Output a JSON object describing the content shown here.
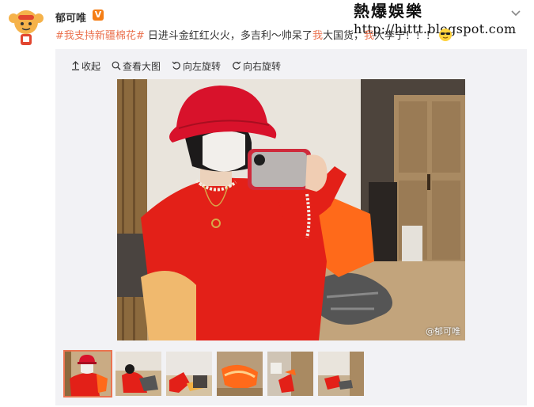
{
  "post": {
    "author": "郁可唯",
    "verified_badge": "V",
    "text_hashtag": "#我支持新疆棉花#",
    "text_part1": " 日进斗金红红火火，多吉利～帅呆了",
    "text_highlight1": "我",
    "text_part2": "大国货，",
    "text_highlight2": "我",
    "text_part3": "大李宁！！！"
  },
  "watermark": {
    "line1": "熱爆娛樂",
    "line2": "http://hittt.blogspot.com"
  },
  "toolbar": {
    "collapse": "收起",
    "view_large": "查看大图",
    "rotate_left": "向左旋转",
    "rotate_right": "向右旋转"
  },
  "photo": {
    "credit": "@郁可唯"
  },
  "colors": {
    "accent": "#eb7350",
    "badge": "#f57e16",
    "media_bg": "#f2f2f5"
  },
  "thumbnails": {
    "count": 6,
    "active_index": 0
  }
}
